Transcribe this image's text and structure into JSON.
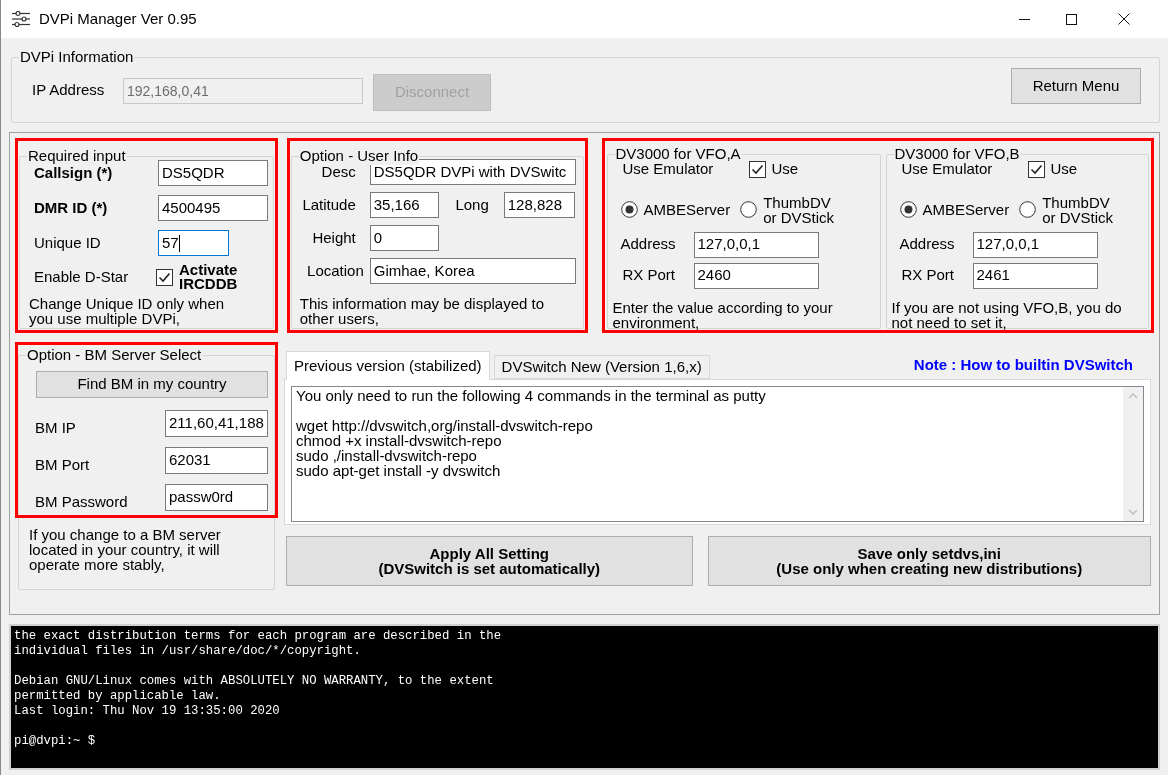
{
  "window": {
    "title": "DVPi Manager Ver 0.95"
  },
  "dvpi_information": {
    "title": "DVPi Information",
    "ip_label": "IP Address",
    "ip_value": "192,168,0,41",
    "disconnect": {
      "label": "Disconnect",
      "disabled": true
    },
    "return_menu": "Return Menu"
  },
  "required_input": {
    "title": "Required input",
    "fields": [
      {
        "label": "Callsign (*)",
        "value": "DS5QDR",
        "bold": true,
        "focused": false
      },
      {
        "label": "DMR ID (*)",
        "value": "4500495",
        "bold": true,
        "focused": false
      },
      {
        "label": "Unique ID",
        "value": "57",
        "bold": false,
        "focused": true
      }
    ],
    "dstar_label": "Enable D-Star",
    "ircddb": {
      "label": "Activate IRCDDB",
      "checked": true
    },
    "note": "Change Unique ID only when you use multiple DVPi,"
  },
  "user_info": {
    "title": "Option - User Info",
    "desc": {
      "label": "Desc",
      "value": "DS5QDR DVPi with DVSwitc"
    },
    "latitude": {
      "label": "Latitude",
      "value": "35,166"
    },
    "long": {
      "label": "Long",
      "value": "128,828"
    },
    "height": {
      "label": "Height",
      "value": "0"
    },
    "location": {
      "label": "Location",
      "value": "Gimhae, Korea"
    },
    "note": "This information may be displayed to other users,"
  },
  "vfo": [
    {
      "title": "DV3000 for VFO,A",
      "emulator_label": "Use Emulator",
      "use": {
        "label": "Use",
        "checked": true
      },
      "modes": [
        {
          "label": "AMBEServer",
          "selected": true
        },
        {
          "label": "ThumbDV or DVStick",
          "selected": false
        }
      ],
      "fields": [
        {
          "label": "Address",
          "value": "127,0,0,1"
        },
        {
          "label": "RX Port",
          "value": "2460"
        }
      ],
      "note": "Enter the value according to your environment,"
    },
    {
      "title": "DV3000 for VFO,B",
      "emulator_label": "Use Emulator",
      "use": {
        "label": "Use",
        "checked": true
      },
      "modes": [
        {
          "label": "AMBEServer",
          "selected": true
        },
        {
          "label": "ThumbDV or DVStick",
          "selected": false
        }
      ],
      "fields": [
        {
          "label": "Address",
          "value": "127,0,0,1"
        },
        {
          "label": "RX Port",
          "value": "2461"
        }
      ],
      "note": "If you are not using VFO,B, you do not need to set it,"
    }
  ],
  "bm_server": {
    "title": "Option - BM Server Select",
    "find_button": "Find BM in my country",
    "fields": [
      {
        "label": "BM IP",
        "value": "211,60,41,188"
      },
      {
        "label": "BM Port",
        "value": "62031"
      },
      {
        "label": "BM Password",
        "value": "passw0rd"
      }
    ],
    "note": "If you change to a BM server located in your country, it will operate more stably,"
  },
  "tabs": [
    {
      "label": "Previous version (stabilized)",
      "selected": true
    },
    {
      "label": "DVSwitch New (Version 1,6,x)",
      "selected": false
    }
  ],
  "note_link": "Note : How to builtin DVSwitch",
  "instructions": [
    [
      "You only need to run the following 4 commands in the terminal as putty"
    ],
    [
      "wget http://dvswitch,org/install-dvswitch-repo",
      "chmod +x install-dvswitch-repo",
      "sudo ,/install-dvswitch-repo",
      "sudo apt-get install -y dvswitch"
    ]
  ],
  "action_buttons": [
    {
      "line1": "Apply All Setting",
      "line2": "(DVSwitch is set automatically)"
    },
    {
      "line1": "Save only setdvs,ini",
      "line2": "(Use only when creating new distributions)"
    }
  ],
  "terminal": [
    [
      "the exact distribution terms for each program are described in the",
      "individual files in /usr/share/doc/*/copyright."
    ],
    [
      "Debian GNU/Linux comes with ABSOLUTELY NO WARRANTY, to the extent",
      "permitted by applicable law.",
      "Last login: Thu Nov 19 13:35:00 2020"
    ],
    [
      "pi@dvpi:~ $"
    ]
  ]
}
